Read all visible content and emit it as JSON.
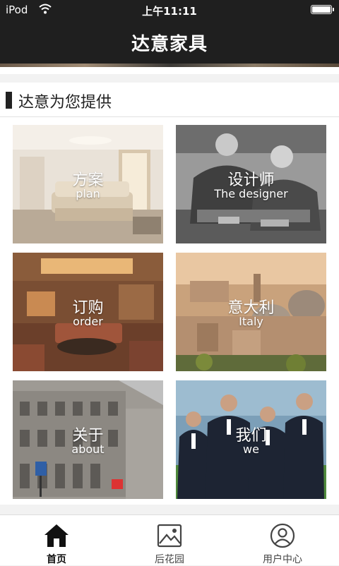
{
  "status_bar": {
    "carrier": "iPod",
    "time": "上午11:11"
  },
  "header": {
    "title": "达意家具"
  },
  "section": {
    "title": "达意为您提供"
  },
  "tiles": [
    {
      "zh": "方案",
      "en": "plan"
    },
    {
      "zh": "设计师",
      "en": "The designer"
    },
    {
      "zh": "订购",
      "en": "order"
    },
    {
      "zh": "意大利",
      "en": "Italy"
    },
    {
      "zh": "关于",
      "en": "about"
    },
    {
      "zh": "我们",
      "en": "we"
    }
  ],
  "tabbar": {
    "items": [
      {
        "label": "首页",
        "icon": "home-icon",
        "active": true
      },
      {
        "label": "后花园",
        "icon": "picture-icon",
        "active": false
      },
      {
        "label": "用户中心",
        "icon": "user-icon",
        "active": false
      }
    ]
  },
  "colors": {
    "header_bg": "#1f1f1f",
    "accent": "#222222",
    "page_bg": "#f2f2f2"
  }
}
